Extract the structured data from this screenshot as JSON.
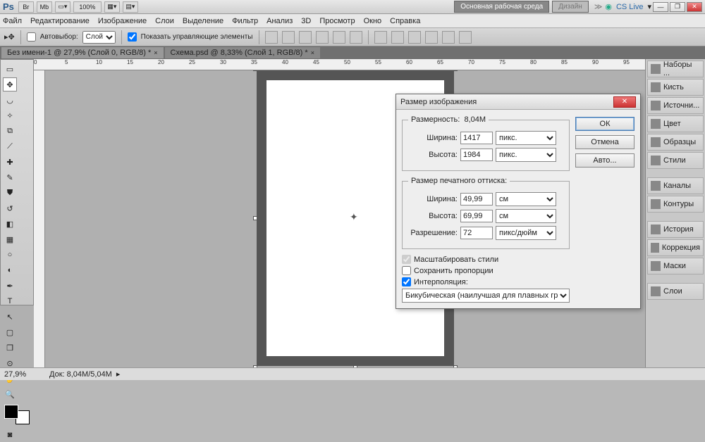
{
  "titlebar": {
    "zoom_display": "100%",
    "workspace_main": "Основная рабочая среда",
    "workspace_dim": "Дизайн",
    "cslive": "CS Live"
  },
  "menu": [
    "Файл",
    "Редактирование",
    "Изображение",
    "Слои",
    "Выделение",
    "Фильтр",
    "Анализ",
    "3D",
    "Просмотр",
    "Окно",
    "Справка"
  ],
  "optbar": {
    "autoselect": "Автовыбор:",
    "autoselect_value": "Слой",
    "show_controls": "Показать управляющие элементы"
  },
  "tabs": [
    {
      "label": "Без имени-1 @ 27,9% (Слой 0, RGB/8) *"
    },
    {
      "label": "Схема.psd @ 8,33% (Слой 1, RGB/8) *"
    }
  ],
  "status": {
    "zoom": "27,9%",
    "doc": "Док: 8,04M/5,04M"
  },
  "panels": [
    "Наборы ...",
    "Кисть",
    "Источни...",
    "Цвет",
    "Образцы",
    "Стили",
    "",
    "Каналы",
    "Контуры",
    "",
    "История",
    "Коррекция",
    "Маски",
    "",
    "Слои"
  ],
  "dialog": {
    "title": "Размер изображения",
    "dim_label": "Размерность:",
    "dim_value": "8,04M",
    "width_label": "Ширина:",
    "height_label": "Высота:",
    "px_width": "1417",
    "px_height": "1984",
    "unit_px": "пикс.",
    "print_legend": "Размер печатного оттиска:",
    "print_width": "49,99",
    "print_height": "69,99",
    "unit_cm": "см",
    "res_label": "Разрешение:",
    "res_value": "72",
    "unit_res": "пикс/дюйм",
    "scale_styles": "Масштабировать стили",
    "constrain": "Сохранить пропорции",
    "interp_label": "Интерполяция:",
    "interp_value": "Бикубическая (наилучшая для плавных градиентов)",
    "ok": "ОК",
    "cancel": "Отмена",
    "auto": "Авто..."
  }
}
